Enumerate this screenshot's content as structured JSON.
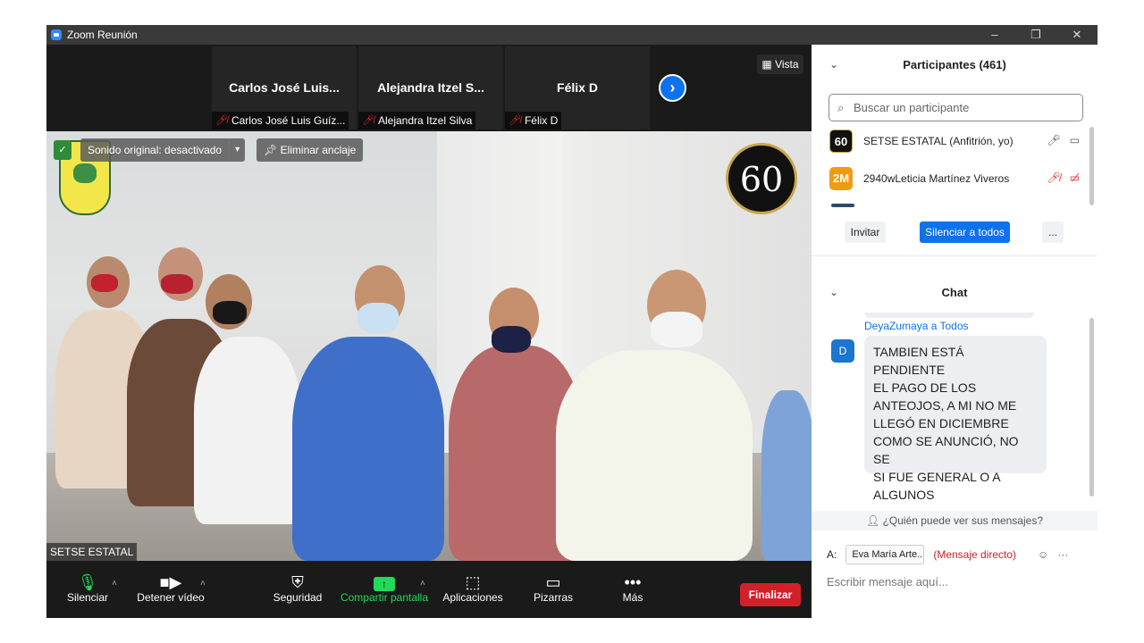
{
  "window": {
    "title": "Zoom Reunión",
    "controls": [
      "–",
      "❐",
      "✕"
    ]
  },
  "gallery": {
    "tiles": [
      {
        "name": "Carlos José Luis...",
        "label": "Carlos José Luis Guíz..."
      },
      {
        "name": "Alejandra Itzel S...",
        "label": "Alejandra Itzel Silva"
      },
      {
        "name": "Félix D",
        "label": "Félix D"
      }
    ],
    "next_icon": "chevron-right-icon",
    "view_label": "Vista"
  },
  "main_video": {
    "original_sound": "Sonido original: desactivado",
    "unpin": "Eliminar anclaje",
    "badge_60": "60",
    "speaker": "SETSE ESTATAL"
  },
  "toolbar": {
    "mute": "Silenciar",
    "video": "Detener vídeo",
    "security": "Seguridad",
    "share": "Compartir pantalla",
    "apps": "Aplicaciones",
    "whiteboards": "Pizarras",
    "more": "Más",
    "end": "Finalizar"
  },
  "participants": {
    "title": "Participantes (461)",
    "search_placeholder": "Buscar un participante",
    "list": [
      {
        "avatar": "60",
        "name": "SETSE ESTATAL (Anfitrión, yo)",
        "avatar_color": "#111111"
      },
      {
        "avatar": "2M",
        "name": "2940wLeticia Martínez Viveros",
        "avatar_color": "#f29b12"
      }
    ],
    "invite": "Invitar",
    "mute_all": "Silenciar a todos",
    "more": "..."
  },
  "chat": {
    "title": "Chat",
    "sender": "DeyaZumaya a Todos",
    "avatar": "D",
    "message_lines": [
      "TAMBIEN ESTÁ PENDIENTE",
      "EL PAGO DE LOS",
      "ANTEOJOS, A MI NO ME",
      "LLEGÓ EN DICIEMBRE",
      "COMO SE ANUNCIÓ, NO SE",
      "SI FUE GENERAL O A",
      "ALGUNOS"
    ],
    "who_sees": "¿Quién puede ver sus mensajes?",
    "to_label": "A:",
    "to_value": "Eva María Arte...",
    "direct": "(Mensaje directo)",
    "input_placeholder": "Escribir mensaje aquí..."
  },
  "colors": {
    "accent": "#0e72ed",
    "end": "#d12029",
    "share": "#23d959",
    "danger": "#e02828"
  }
}
